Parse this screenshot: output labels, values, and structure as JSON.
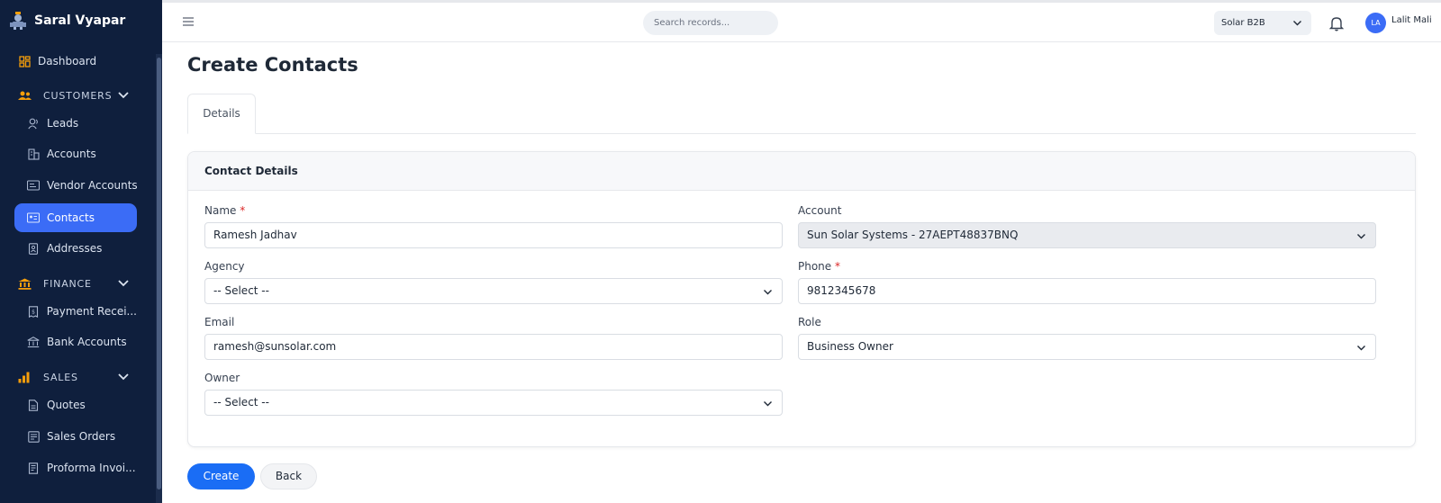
{
  "app": {
    "name": "Saral Vyapar"
  },
  "colors": {
    "sidebar_bg": "#0f1f3d",
    "accent": "#3b6cf6",
    "primary_button": "#1a6df5",
    "section_icon": "#f59e0b"
  },
  "sidebar": {
    "dashboard": {
      "label": "Dashboard",
      "icon": "dashboard-icon"
    },
    "customers": {
      "label": "CUSTOMERS",
      "icon": "users-icon",
      "items": [
        {
          "label": "Leads",
          "icon": "person-icon"
        },
        {
          "label": "Accounts",
          "icon": "building-icon"
        },
        {
          "label": "Vendor Accounts",
          "icon": "vendor-card-icon"
        },
        {
          "label": "Contacts",
          "icon": "contact-card-icon",
          "active": true
        },
        {
          "label": "Addresses",
          "icon": "address-book-icon"
        }
      ]
    },
    "finance": {
      "label": "FINANCE",
      "icon": "bank-icon",
      "items": [
        {
          "label": "Payment Recei...",
          "icon": "receipt-icon"
        },
        {
          "label": "Bank Accounts",
          "icon": "bank-outline-icon"
        }
      ]
    },
    "sales": {
      "label": "SALES",
      "icon": "bar-chart-icon",
      "items": [
        {
          "label": "Quotes",
          "icon": "document-icon"
        },
        {
          "label": "Sales Orders",
          "icon": "orders-icon"
        },
        {
          "label": "Proforma Invoi...",
          "icon": "invoice-icon"
        }
      ]
    }
  },
  "topbar": {
    "search_placeholder": "Search records...",
    "org_selected": "Solar B2B",
    "user_initials": "LA",
    "user_name": "Lalit Mali"
  },
  "page": {
    "title": "Create Contacts",
    "tabs": [
      {
        "label": "Details"
      }
    ],
    "card_title": "Contact Details",
    "fields": {
      "name": {
        "label": "Name",
        "required": "*",
        "value": "Ramesh Jadhav"
      },
      "account": {
        "label": "Account",
        "value": "Sun Solar Systems - 27AEPT48837BNQ"
      },
      "agency": {
        "label": "Agency",
        "value": "-- Select --"
      },
      "phone": {
        "label": "Phone",
        "required": "*",
        "value": "9812345678"
      },
      "email": {
        "label": "Email",
        "value": "ramesh@sunsolar.com"
      },
      "role": {
        "label": "Role",
        "value": "Business Owner"
      },
      "owner": {
        "label": "Owner",
        "value": "-- Select --"
      }
    },
    "buttons": {
      "create": "Create",
      "back": "Back"
    }
  }
}
